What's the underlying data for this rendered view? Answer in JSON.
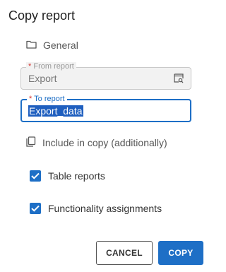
{
  "dialog": {
    "title": "Copy report",
    "general_section": "General",
    "from_report": {
      "required_mark": "*",
      "label": "From report",
      "value": "Export"
    },
    "to_report": {
      "required_mark": "*",
      "label": "To report",
      "value": "Export_data"
    },
    "include_section": "Include in copy (additionally)",
    "options": [
      {
        "label": "Table reports",
        "checked": true
      },
      {
        "label": "Functionality assignments",
        "checked": true
      }
    ],
    "cancel_label": "CANCEL",
    "copy_label": "COPY"
  },
  "colors": {
    "accent": "#1e6fc6",
    "required": "#d6332f",
    "readonly_bg": "#f2f2f2"
  },
  "icons": [
    "folder-icon",
    "lookup-icon",
    "copy-icon",
    "checkbox-checked-icon"
  ]
}
